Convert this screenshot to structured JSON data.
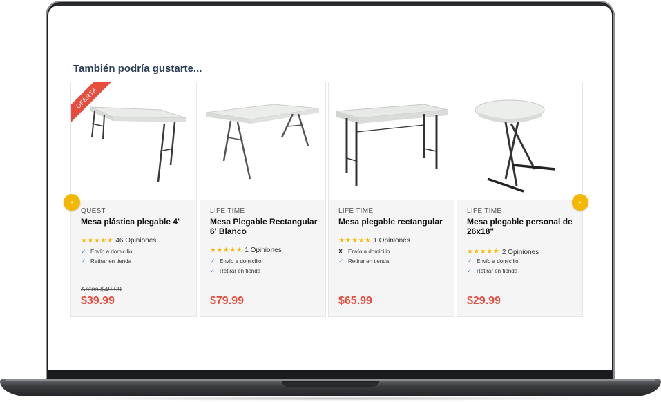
{
  "section_title": "También podría gustarte...",
  "nav": {
    "prev_icon": "◂",
    "next_icon": "▸"
  },
  "products": [
    {
      "badge": "OFERTA",
      "brand": "QUEST",
      "name": "Mesa plástica plegable 4'",
      "stars": "★★★★★",
      "reviews": "46 Opiniones",
      "features": [
        {
          "icon": "✓",
          "label": "Envío a domicilio"
        },
        {
          "icon": "✓",
          "label": "Retirar en tienda"
        }
      ],
      "old_price": "Antes $49.99",
      "price": "$39.99"
    },
    {
      "brand": "LIFE TIME",
      "name": "Mesa Plegable Rectangular 6' Blanco",
      "stars": "★★★★★",
      "reviews": "1 Opiniones",
      "features": [
        {
          "icon": "✓",
          "label": "Envío a domicilio"
        },
        {
          "icon": "✓",
          "label": "Retirar en tienda"
        }
      ],
      "price": "$79.99"
    },
    {
      "brand": "LIFE TIME",
      "name": "Mesa plegable rectangular",
      "stars": "★★★★★",
      "reviews": "1 Opiniones",
      "features": [
        {
          "icon": "X",
          "label": "Envío a domicilio"
        },
        {
          "icon": "✓",
          "label": "Retirar en tienda"
        }
      ],
      "price": "$65.99"
    },
    {
      "brand": "LIFE TIME",
      "name": "Mesa plegable personal de 26x18\"",
      "stars": "★★★★⯪",
      "reviews": "2 Opiniones",
      "features": [
        {
          "icon": "✓",
          "label": "Envío a domicilio"
        },
        {
          "icon": "✓",
          "label": "Retirar en tienda"
        }
      ],
      "price": "$29.99"
    }
  ],
  "colors": {
    "accent": "#f5b800",
    "price": "#e74c3c",
    "check": "#3b82c4"
  }
}
